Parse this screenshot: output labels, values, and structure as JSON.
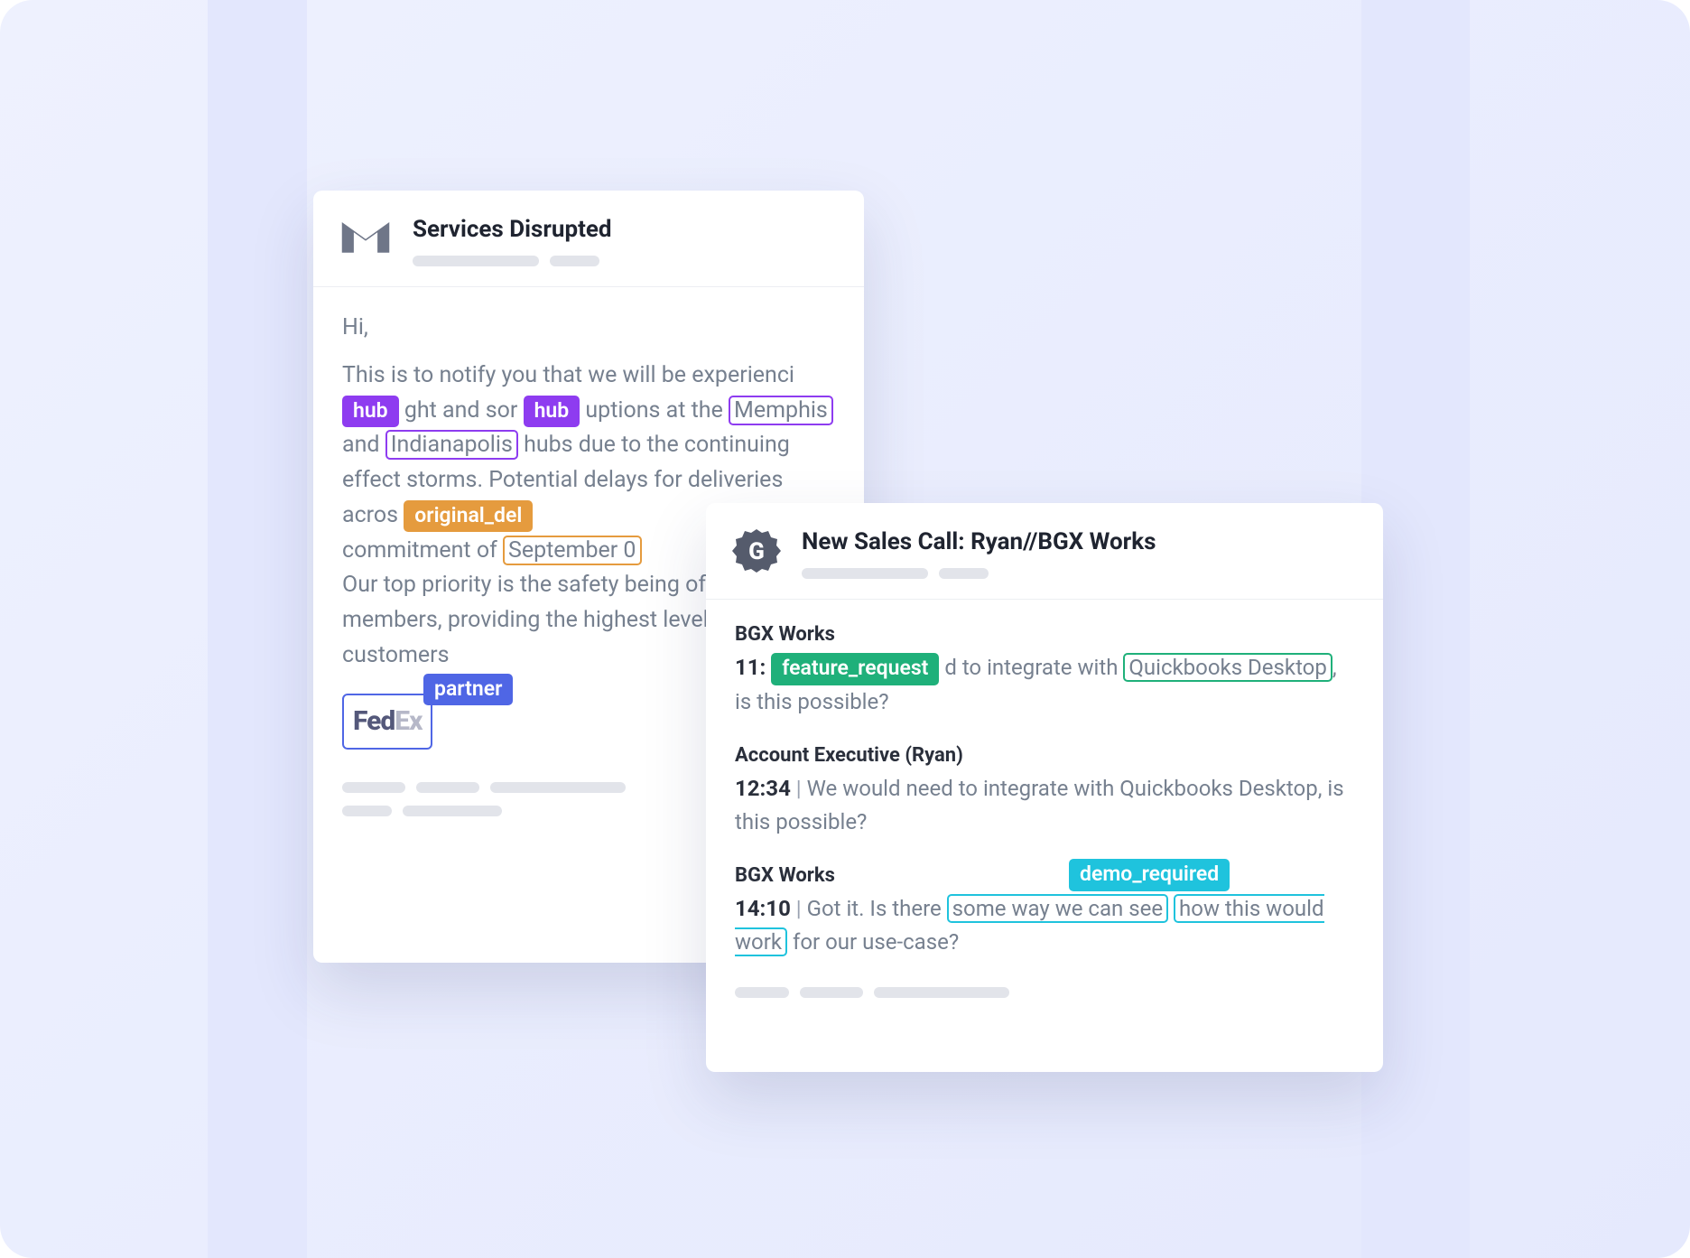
{
  "email": {
    "title": "Services Disrupted",
    "greeting": "Hi,",
    "pre_hub1": "This is to notify you that we will be experienci",
    "hub_tag": "hub",
    "mid_hub": "ght and sor",
    "post_hub2": "uptions at the",
    "ent_memphis": "Memphis",
    "and": "and",
    "ent_indy": "Indianapolis",
    "after_cities": "hubs due to the continuing effect storms. Potential delays for deliveries acros",
    "orig_del_tag": "original_del",
    "after_orig1": "commitment of",
    "ent_sept": "September 0",
    "tail": "Our top priority is the safety being of out team members, providing the highest level o our customers",
    "partner_tag": "partner",
    "fedex_fed": "Fed",
    "fedex_ex": "Ex"
  },
  "call": {
    "title": "New Sales Call: Ryan//BGX Works",
    "msg1": {
      "from": "BGX Works",
      "time": "11:",
      "feature_tag": "feature_request",
      "text_a": "d to integrate with",
      "ent_qb": "Quickbooks Desktop",
      "text_b": ", is this possible?"
    },
    "msg2": {
      "from": "Account Executive (Ryan)",
      "time": "12:34",
      "text": "We would need to integrate with Quickbooks Desktop, is this possible?"
    },
    "msg3": {
      "from": "BGX Works",
      "time": "14:10",
      "demo_tag": "demo_required",
      "text_a": "Got it. Is there",
      "ent_demo_a": "some way we can see",
      "ent_demo_b": "how this would work",
      "text_b": "for our use-case?"
    }
  }
}
